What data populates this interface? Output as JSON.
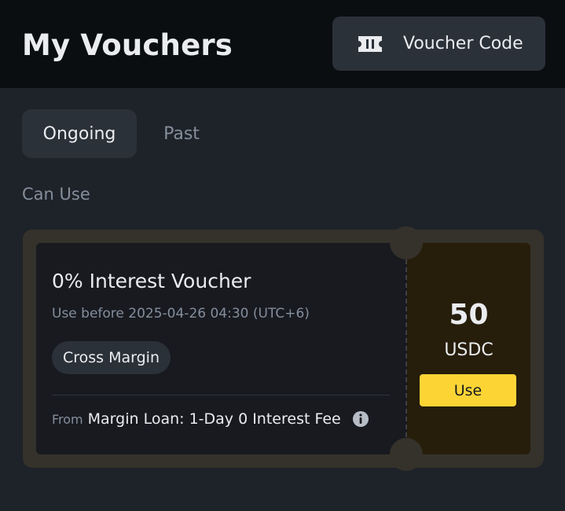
{
  "header": {
    "title": "My Vouchers",
    "voucher_code_button": {
      "label": "Voucher Code",
      "icon": "ticket-icon"
    }
  },
  "tabs": [
    {
      "label": "Ongoing",
      "active": true
    },
    {
      "label": "Past",
      "active": false
    }
  ],
  "section_label": "Can Use",
  "vouchers": [
    {
      "title": "0% Interest Voucher",
      "expiry": "Use before 2025-04-26 04:30 (UTC+6)",
      "tag": "Cross Margin",
      "from_label": "From",
      "from_source": "Margin Loan: 1-Day 0 Interest Fee",
      "amount": "50",
      "unit": "USDC",
      "use_label": "Use"
    }
  ],
  "colors": {
    "background": "#1e2329",
    "header_background": "#0b0e11",
    "accent_yellow": "#fcd535",
    "muted_text": "#848e9c"
  }
}
